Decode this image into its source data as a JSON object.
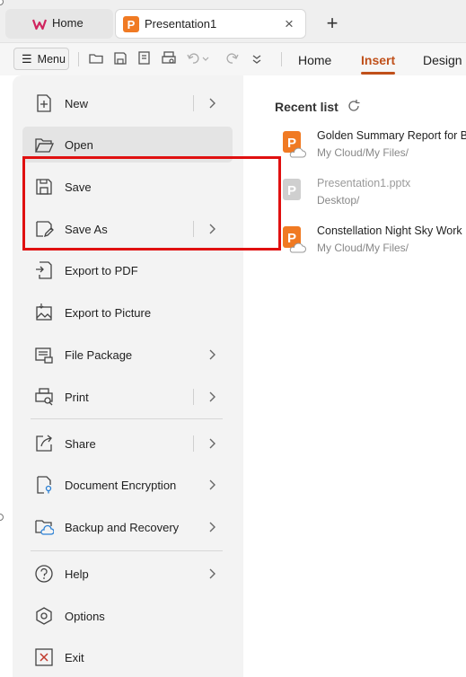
{
  "tabs": [
    {
      "label": "Home",
      "icon": "wps-logo-icon"
    },
    {
      "label": "Presentation1",
      "icon": "presentation-file-icon",
      "active": true
    }
  ],
  "toolbar": {
    "menu_label": "Menu",
    "ribbon_tabs": [
      {
        "label": "Home"
      },
      {
        "label": "Insert",
        "active": true
      },
      {
        "label": "Design"
      }
    ]
  },
  "menu": {
    "items": [
      {
        "label": "New",
        "icon": "new-document-icon",
        "submenu": true
      },
      {
        "label": "Open",
        "icon": "folder-open-icon",
        "highlighted": true
      },
      {
        "label": "Save",
        "icon": "save-icon"
      },
      {
        "label": "Save As",
        "icon": "save-as-icon",
        "submenu": true
      },
      {
        "label": "Export to PDF",
        "icon": "export-pdf-icon"
      },
      {
        "label": "Export to Picture",
        "icon": "export-picture-icon"
      },
      {
        "label": "File Package",
        "icon": "file-package-icon",
        "submenu": true
      },
      {
        "label": "Print",
        "icon": "print-icon",
        "submenu": true
      },
      {
        "label": "Share",
        "icon": "share-icon",
        "submenu": true
      },
      {
        "label": "Document Encryption",
        "icon": "document-lock-icon",
        "submenu": true
      },
      {
        "label": "Backup and Recovery",
        "icon": "cloud-backup-icon",
        "submenu": true
      },
      {
        "label": "Help",
        "icon": "help-icon",
        "submenu": true
      },
      {
        "label": "Options",
        "icon": "gear-icon"
      },
      {
        "label": "Exit",
        "icon": "exit-icon"
      }
    ]
  },
  "recent": {
    "title": "Recent list",
    "files": [
      {
        "name": "Golden Summary Report for Bu",
        "path": "My Cloud/My Files/",
        "cloud": true
      },
      {
        "name": "Presentation1.pptx",
        "path": "Desktop/",
        "cloud": false
      },
      {
        "name": "Constellation Night Sky Work I",
        "path": "My Cloud/My Files/",
        "cloud": true
      }
    ]
  },
  "colors": {
    "accent": "#c0501a",
    "ppt_orange": "#f07a23",
    "highlight_box": "#e01010"
  }
}
